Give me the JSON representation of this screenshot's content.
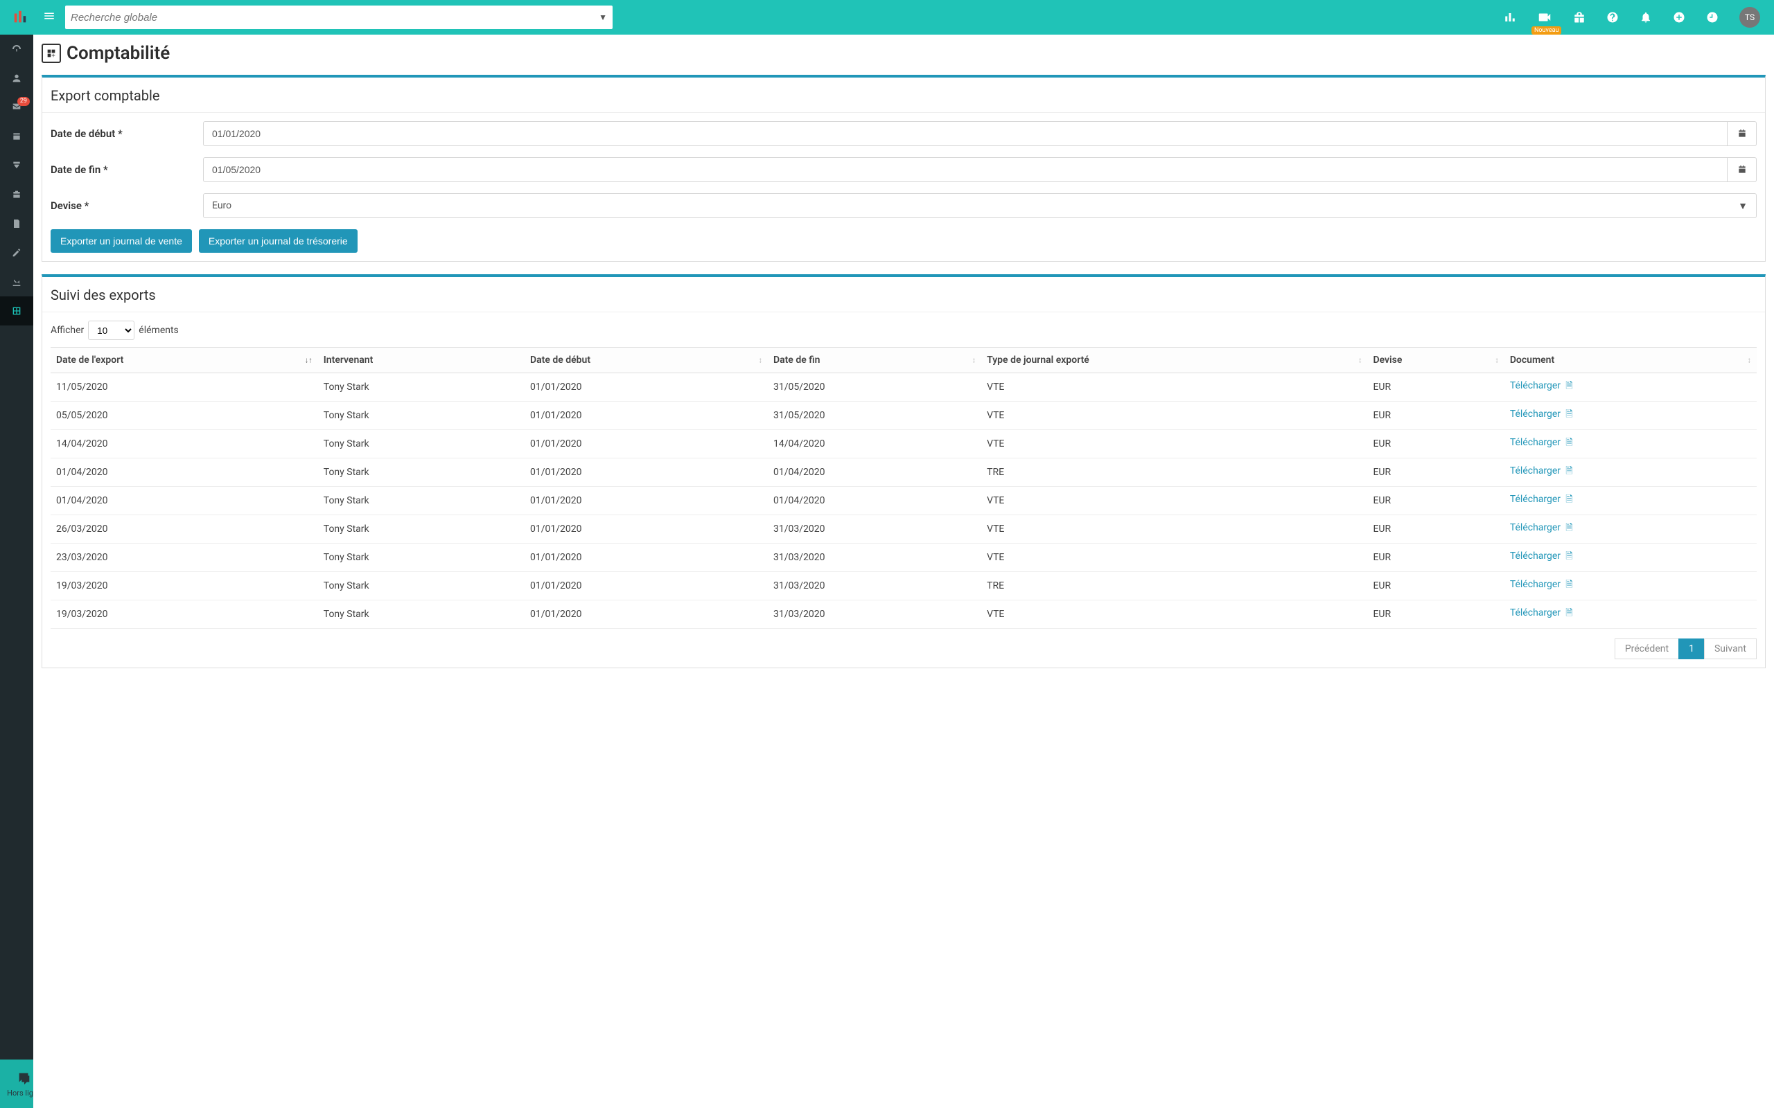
{
  "header": {
    "search_placeholder": "Recherche globale",
    "nouveau_badge": "Nouveau",
    "avatar_initials": "TS"
  },
  "sidebar": {
    "badge_count": "29",
    "chat_label": "Hors ligne"
  },
  "page": {
    "title": "Comptabilité"
  },
  "export_panel": {
    "header": "Export comptable",
    "start_label": "Date de début *",
    "start_value": "01/01/2020",
    "end_label": "Date de fin *",
    "end_value": "01/05/2020",
    "currency_label": "Devise *",
    "currency_value": "Euro",
    "btn_sales": "Exporter un journal de vente",
    "btn_treasury": "Exporter un journal de trésorerie"
  },
  "followup_panel": {
    "header": "Suivi des exports",
    "show_prefix": "Afficher",
    "show_value": "10",
    "show_suffix": "éléments",
    "columns": {
      "export_date": "Date de l'export",
      "intervenant": "Intervenant",
      "start": "Date de début",
      "end": "Date de fin",
      "type": "Type de journal exporté",
      "currency": "Devise",
      "document": "Document"
    },
    "download_label": "Télécharger",
    "rows": [
      {
        "export_date": "11/05/2020",
        "intervenant": "Tony Stark",
        "start": "01/01/2020",
        "end": "31/05/2020",
        "type": "VTE",
        "currency": "EUR"
      },
      {
        "export_date": "05/05/2020",
        "intervenant": "Tony Stark",
        "start": "01/01/2020",
        "end": "31/05/2020",
        "type": "VTE",
        "currency": "EUR"
      },
      {
        "export_date": "14/04/2020",
        "intervenant": "Tony Stark",
        "start": "01/01/2020",
        "end": "14/04/2020",
        "type": "VTE",
        "currency": "EUR"
      },
      {
        "export_date": "01/04/2020",
        "intervenant": "Tony Stark",
        "start": "01/01/2020",
        "end": "01/04/2020",
        "type": "TRE",
        "currency": "EUR"
      },
      {
        "export_date": "01/04/2020",
        "intervenant": "Tony Stark",
        "start": "01/01/2020",
        "end": "01/04/2020",
        "type": "VTE",
        "currency": "EUR"
      },
      {
        "export_date": "26/03/2020",
        "intervenant": "Tony Stark",
        "start": "01/01/2020",
        "end": "31/03/2020",
        "type": "VTE",
        "currency": "EUR"
      },
      {
        "export_date": "23/03/2020",
        "intervenant": "Tony Stark",
        "start": "01/01/2020",
        "end": "31/03/2020",
        "type": "VTE",
        "currency": "EUR"
      },
      {
        "export_date": "19/03/2020",
        "intervenant": "Tony Stark",
        "start": "01/01/2020",
        "end": "31/03/2020",
        "type": "TRE",
        "currency": "EUR"
      },
      {
        "export_date": "19/03/2020",
        "intervenant": "Tony Stark",
        "start": "01/01/2020",
        "end": "31/03/2020",
        "type": "VTE",
        "currency": "EUR"
      }
    ]
  },
  "pager": {
    "prev": "Précédent",
    "current": "1",
    "next": "Suivant"
  }
}
